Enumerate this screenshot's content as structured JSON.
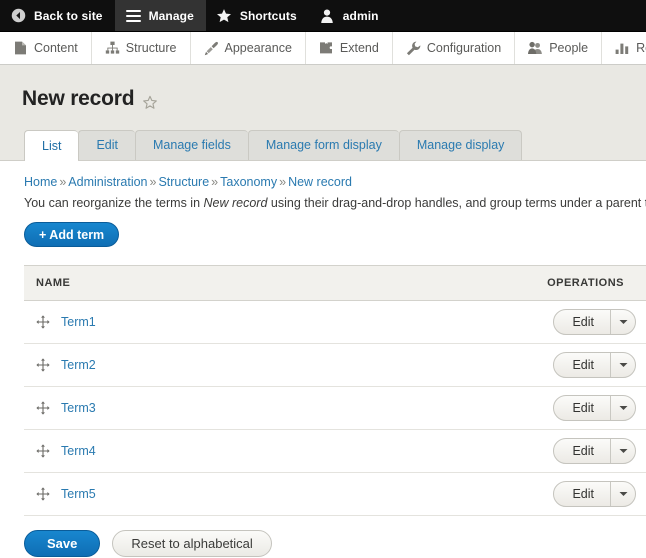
{
  "toolbar_top": {
    "items": [
      {
        "label": "Back to site",
        "icon": "back-arrow-icon",
        "active": false
      },
      {
        "label": "Manage",
        "icon": "hamburger-icon",
        "active": true
      },
      {
        "label": "Shortcuts",
        "icon": "star-icon",
        "active": false
      },
      {
        "label": "admin",
        "icon": "user-icon",
        "active": false
      }
    ]
  },
  "toolbar_sub": {
    "items": [
      {
        "label": "Content",
        "icon": "file-icon"
      },
      {
        "label": "Structure",
        "icon": "sitemap-icon"
      },
      {
        "label": "Appearance",
        "icon": "paintbrush-icon"
      },
      {
        "label": "Extend",
        "icon": "puzzle-icon"
      },
      {
        "label": "Configuration",
        "icon": "wrench-icon"
      },
      {
        "label": "People",
        "icon": "people-icon"
      },
      {
        "label": "Reports",
        "icon": "bar-chart-icon"
      }
    ]
  },
  "page": {
    "title": "New record",
    "bookmark_icon": "star-outline-icon"
  },
  "tabs": [
    {
      "label": "List",
      "active": true
    },
    {
      "label": "Edit",
      "active": false
    },
    {
      "label": "Manage fields",
      "active": false
    },
    {
      "label": "Manage form display",
      "active": false
    },
    {
      "label": "Manage display",
      "active": false
    }
  ],
  "breadcrumb": {
    "separator": "»",
    "items": [
      "Home",
      "Administration",
      "Structure",
      "Taxonomy",
      "New record"
    ]
  },
  "description": {
    "before": "You can reorganize the terms in ",
    "emphasis": "New record",
    "after": " using their drag-and-drop handles, and group terms under a parent term"
  },
  "actions": {
    "add_term_label": "+ Add term",
    "save_label": "Save",
    "reset_label": "Reset to alphabetical"
  },
  "table": {
    "columns": [
      "NAME",
      "OPERATIONS"
    ],
    "operation_label": "Edit",
    "dropdown_icon": "chevron-down-icon",
    "drag_icon": "drag-handle-icon",
    "rows": [
      {
        "name": "Term1"
      },
      {
        "name": "Term2"
      },
      {
        "name": "Term3"
      },
      {
        "name": "Term4"
      },
      {
        "name": "Term5"
      }
    ]
  },
  "colors": {
    "toolbar_bg": "#0f0f0f",
    "toolbar_active": "#333333",
    "page_head_bg": "#e9e8e3",
    "link_blue": "#2a7ab0",
    "primary_button": "#0f73bd",
    "table_header_bg": "#f2f1ed"
  }
}
